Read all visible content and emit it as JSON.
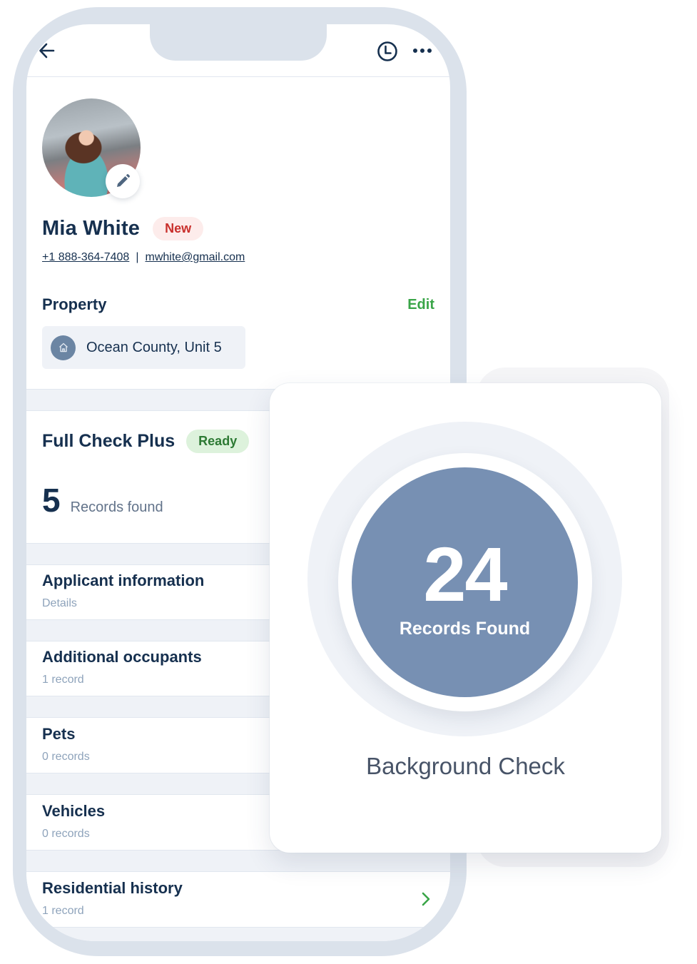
{
  "header": {
    "back_icon": "arrow-left-icon",
    "history_icon": "clock-icon",
    "more_icon": "more-horizontal-icon"
  },
  "profile": {
    "name": "Mia White",
    "status_badge": "New",
    "phone": "+1 888-364-7408",
    "separator": "|",
    "email": "mwhite@gmail.com",
    "avatar_edit_icon": "pencil-icon"
  },
  "property": {
    "section_title": "Property",
    "edit_label": "Edit",
    "icon": "home-icon",
    "value": "Ocean County, Unit 5"
  },
  "check": {
    "title": "Full Check Plus",
    "status_badge": "Ready",
    "records_count": "5",
    "records_label": "Records found"
  },
  "sections": [
    {
      "title": "Applicant information",
      "subtitle": "Details"
    },
    {
      "title": "Additional occupants",
      "subtitle": "1 record"
    },
    {
      "title": "Pets",
      "subtitle": "0 records"
    },
    {
      "title": "Vehicles",
      "subtitle": "0 records"
    },
    {
      "title": "Residential history",
      "subtitle": "1 record"
    }
  ],
  "summary_card": {
    "count": "24",
    "count_label": "Records Found",
    "title": "Background Check"
  },
  "colors": {
    "frame": "#dbe2eb",
    "primary_text": "#16304f",
    "accent_green": "#3aa548",
    "new_badge_bg": "#fdeceb",
    "new_badge_text": "#c9302c",
    "ready_badge_bg": "#ddf2dc",
    "ready_badge_text": "#2d7a34",
    "circle_fill": "#7790b3",
    "muted_text": "#8ea3bb"
  }
}
